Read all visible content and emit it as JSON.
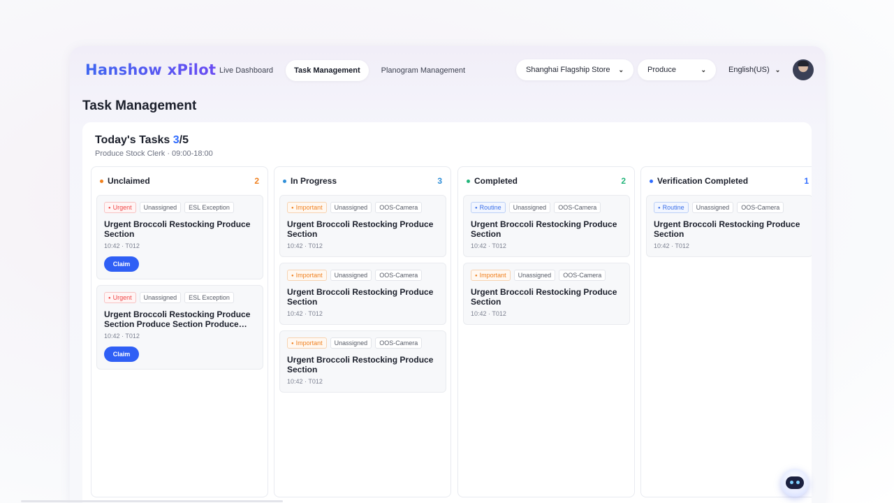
{
  "header": {
    "logo": "Hanshow xPilot",
    "nav": [
      {
        "label": "Live Dashboard",
        "active": false
      },
      {
        "label": "Task Management",
        "active": true
      },
      {
        "label": "Planogram Management",
        "active": false
      }
    ],
    "store_selector": "Shanghai Flagship Store",
    "department_selector": "Produce",
    "language": "English(US)"
  },
  "page_title": "Task Management",
  "today": {
    "label": "Today's Tasks",
    "done": "3",
    "total": "/5",
    "shift": "Produce Stock Clerk · 09:00-18:00"
  },
  "columns": [
    {
      "title": "Unclaimed",
      "count": "2",
      "color": "#f0801e",
      "cards": [
        {
          "priority": "Urgent",
          "level": "urgent",
          "assignee": "Unassigned",
          "source": "ESL Exception",
          "title": "Urgent Broccoli Restocking Produce Section",
          "meta": "10:42 · T012",
          "action": "Claim"
        },
        {
          "priority": "Urgent",
          "level": "urgent",
          "assignee": "Unassigned",
          "source": "ESL Exception",
          "title": "Urgent Broccoli Restocking Produce Section Produce Section Produce Section Produce Section",
          "meta": "10:42 · T012",
          "action": "Claim"
        }
      ]
    },
    {
      "title": "In Progress",
      "count": "3",
      "color": "#2f8fd8",
      "cards": [
        {
          "priority": "Important",
          "level": "important",
          "assignee": "Unassigned",
          "source": "OOS-Camera",
          "title": "Urgent Broccoli Restocking Produce Section",
          "meta": "10:42 · T012"
        },
        {
          "priority": "Important",
          "level": "important",
          "assignee": "Unassigned",
          "source": "OOS-Camera",
          "title": "Urgent Broccoli Restocking Produce Section",
          "meta": "10:42 · T012"
        },
        {
          "priority": "Important",
          "level": "important",
          "assignee": "Unassigned",
          "source": "OOS-Camera",
          "title": "Urgent Broccoli Restocking Produce Section",
          "meta": "10:42 · T012"
        }
      ]
    },
    {
      "title": "Completed",
      "count": "2",
      "color": "#22b57a",
      "cards": [
        {
          "priority": "Routine",
          "level": "routine",
          "assignee": "Unassigned",
          "source": "OOS-Camera",
          "title": "Urgent Broccoli Restocking Produce Section",
          "meta": "10:42 · T012"
        },
        {
          "priority": "Important",
          "level": "important",
          "assignee": "Unassigned",
          "source": "OOS-Camera",
          "title": "Urgent Broccoli Restocking Produce Section",
          "meta": "10:42 · T012"
        }
      ]
    },
    {
      "title": "Verification Completed",
      "count": "1",
      "color": "#2f6bff",
      "cards": [
        {
          "priority": "Routine",
          "level": "routine",
          "assignee": "Unassigned",
          "source": "OOS-Camera",
          "title": "Urgent Broccoli Restocking Produce Section",
          "meta": "10:42 · T012"
        }
      ]
    }
  ],
  "assistant_icon": "robot-assistant-icon"
}
